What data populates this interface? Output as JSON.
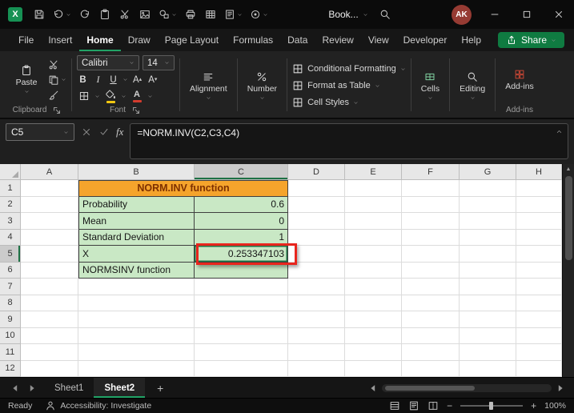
{
  "colors": {
    "accent_green": "#21A366",
    "share_button_green": "#0F7B41",
    "title_fill_orange": "#F5A42C",
    "title_text_maroon": "#7E3000",
    "cell_fill_green": "#C9E8C5",
    "annotation_red": "#E8251D",
    "avatar_red": "#963B33"
  },
  "titlebar": {
    "app": "Excel",
    "qat_icons": [
      {
        "name": "save-icon"
      },
      {
        "name": "undo-icon",
        "chevron": true
      },
      {
        "name": "redo-icon"
      },
      {
        "name": "clipboard-icon"
      },
      {
        "name": "cut-icon"
      },
      {
        "name": "picture-icon"
      },
      {
        "name": "shapes-icon",
        "chevron": true
      },
      {
        "name": "printer-icon"
      },
      {
        "name": "table-icon"
      },
      {
        "name": "macro-icon",
        "chevron": true
      },
      {
        "name": "record-icon",
        "chevron": true
      }
    ],
    "doc_name": "Book...",
    "avatar_initials": "AK"
  },
  "menubar": {
    "tabs": [
      "File",
      "Insert",
      "Home",
      "Draw",
      "Page Layout",
      "Formulas",
      "Data",
      "Review",
      "View",
      "Developer",
      "Help"
    ],
    "active_tab": "Home",
    "share_label": "Share"
  },
  "ribbon": {
    "clipboard": {
      "paste_label": "Paste",
      "group_label": "Clipboard"
    },
    "font": {
      "font_name": "Calibri",
      "font_size": "14",
      "bold": "B",
      "italic": "I",
      "underline": "U",
      "group_label": "Font"
    },
    "alignment": {
      "label": "Alignment"
    },
    "number": {
      "label": "Number"
    },
    "styles": {
      "items": [
        "Conditional Formatting",
        "Format as Table",
        "Cell Styles"
      ]
    },
    "cells": {
      "label": "Cells"
    },
    "editing": {
      "label": "Editing"
    },
    "addins": {
      "label": "Add-ins",
      "group_label": "Add-ins"
    }
  },
  "formula_bar": {
    "name_box": "C5",
    "fx_label": "fx",
    "formula": "=NORM.INV(C2,C3,C4)"
  },
  "grid": {
    "column_headers": [
      "A",
      "B",
      "C",
      "D",
      "E",
      "F",
      "G",
      "H"
    ],
    "row_headers": [
      "1",
      "2",
      "3",
      "4",
      "5",
      "6",
      "7",
      "8",
      "9",
      "10",
      "11",
      "12"
    ],
    "selected_column": "C",
    "selected_row": "5",
    "active_cell": "C5",
    "merged_title": {
      "ref": "B1",
      "span": 2,
      "text": "NORM.INV function"
    },
    "cells": [
      {
        "ref": "B2",
        "text": "Probability"
      },
      {
        "ref": "C2",
        "text": "0.6",
        "align": "right"
      },
      {
        "ref": "B3",
        "text": "Mean"
      },
      {
        "ref": "C3",
        "text": "0",
        "align": "right"
      },
      {
        "ref": "B4",
        "text": "Standard Deviation"
      },
      {
        "ref": "C4",
        "text": "1",
        "align": "right"
      },
      {
        "ref": "B5",
        "text": "X"
      },
      {
        "ref": "C5",
        "text": "0.253347103",
        "align": "right"
      },
      {
        "ref": "B6",
        "text": "NORMSINV function"
      },
      {
        "ref": "C6",
        "text": ""
      }
    ]
  },
  "sheetbar": {
    "tabs": [
      "Sheet1",
      "Sheet2"
    ],
    "active_tab": "Sheet2",
    "add_label": "+"
  },
  "statusbar": {
    "ready": "Ready",
    "accessibility": "Accessibility: Investigate",
    "zoom": "100%"
  }
}
